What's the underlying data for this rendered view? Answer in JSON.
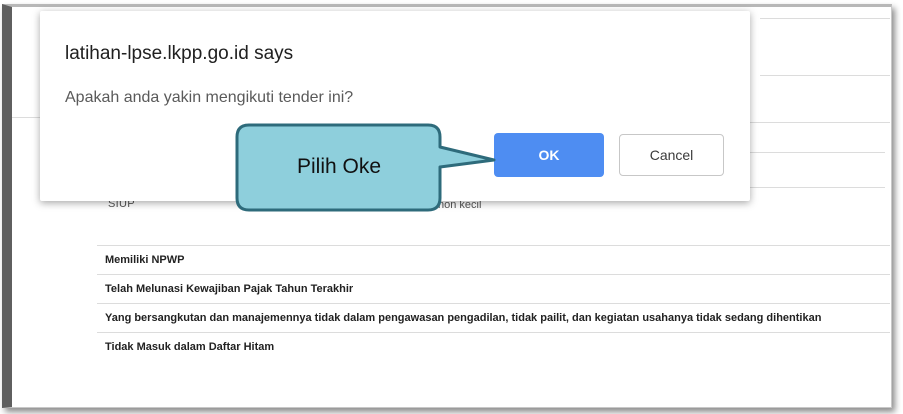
{
  "dialog": {
    "title": "latihan-lpse.lkpp.go.id says",
    "message": "Apakah anda yakin mengikuti tender ini?",
    "ok_label": "OK",
    "cancel_label": "Cancel"
  },
  "callout": {
    "text": "Pilih Oke",
    "fill_color": "#8ecfdc",
    "border_color": "#2e6b7b"
  },
  "background": {
    "partial_label_left": "SIUP",
    "partial_label_right": "non kecil",
    "requirements": [
      "Memiliki NPWP",
      "Telah Melunasi Kewajiban Pajak Tahun Terakhir",
      "Yang bersangkutan dan manajemennya tidak dalam pengawasan pengadilan, tidak pailit, dan kegiatan usahanya tidak sedang dihentikan",
      "Tidak Masuk dalam Daftar Hitam"
    ]
  },
  "colors": {
    "ok_button": "#4e8df2",
    "frame_border": "#5f5f5f"
  }
}
